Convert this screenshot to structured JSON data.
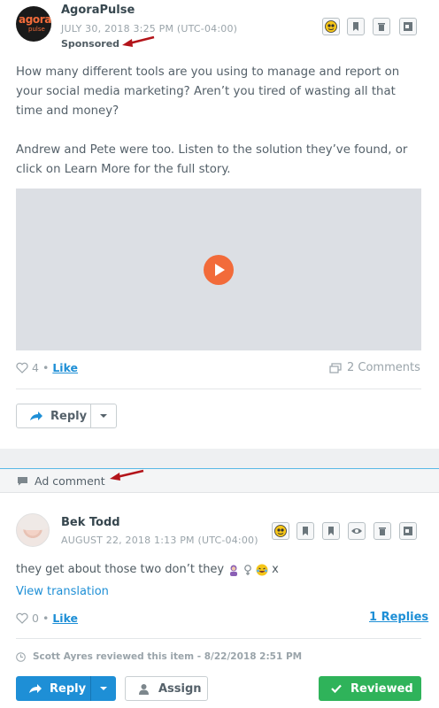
{
  "post": {
    "logo_text_main": "agora",
    "logo_text_sub": "pulse",
    "author": "AgoraPulse",
    "date": "JULY 30, 2018 3:25 PM (UTC-04:00)",
    "sponsored": "Sponsored",
    "paragraph1": "How many different tools are you using to manage and report on your social media marketing? Aren’t you tired of wasting all that time and money?",
    "paragraph2": "Andrew and Pete were too. Listen to the solution they’ve found, or click on Learn More for the full story.",
    "like_count": "4",
    "like_label": "Like",
    "comments_label": "2 Comments",
    "reply_label": "Reply"
  },
  "section": {
    "label": "Ad comment"
  },
  "comment": {
    "author": "Bek Todd",
    "date": "AUGUST 22, 2018 1:13 PM (UTC-04:00)",
    "text": "they get about those two don’t they",
    "text_suffix": "x",
    "view_translation": "View translation",
    "like_count": "0",
    "like_label": "Like",
    "replies_label": "1 Replies",
    "reviewed_by": "Scott Ayres reviewed this item - 8/22/2018 2:51 PM",
    "reply_label": "Reply",
    "assign_label": "Assign",
    "reviewed_label": "Reviewed"
  },
  "colors": {
    "accent_blue": "#1e8fd6",
    "success_green": "#2fb35a",
    "brand_orange": "#f26b3a",
    "annotation_red": "#b3141a"
  }
}
